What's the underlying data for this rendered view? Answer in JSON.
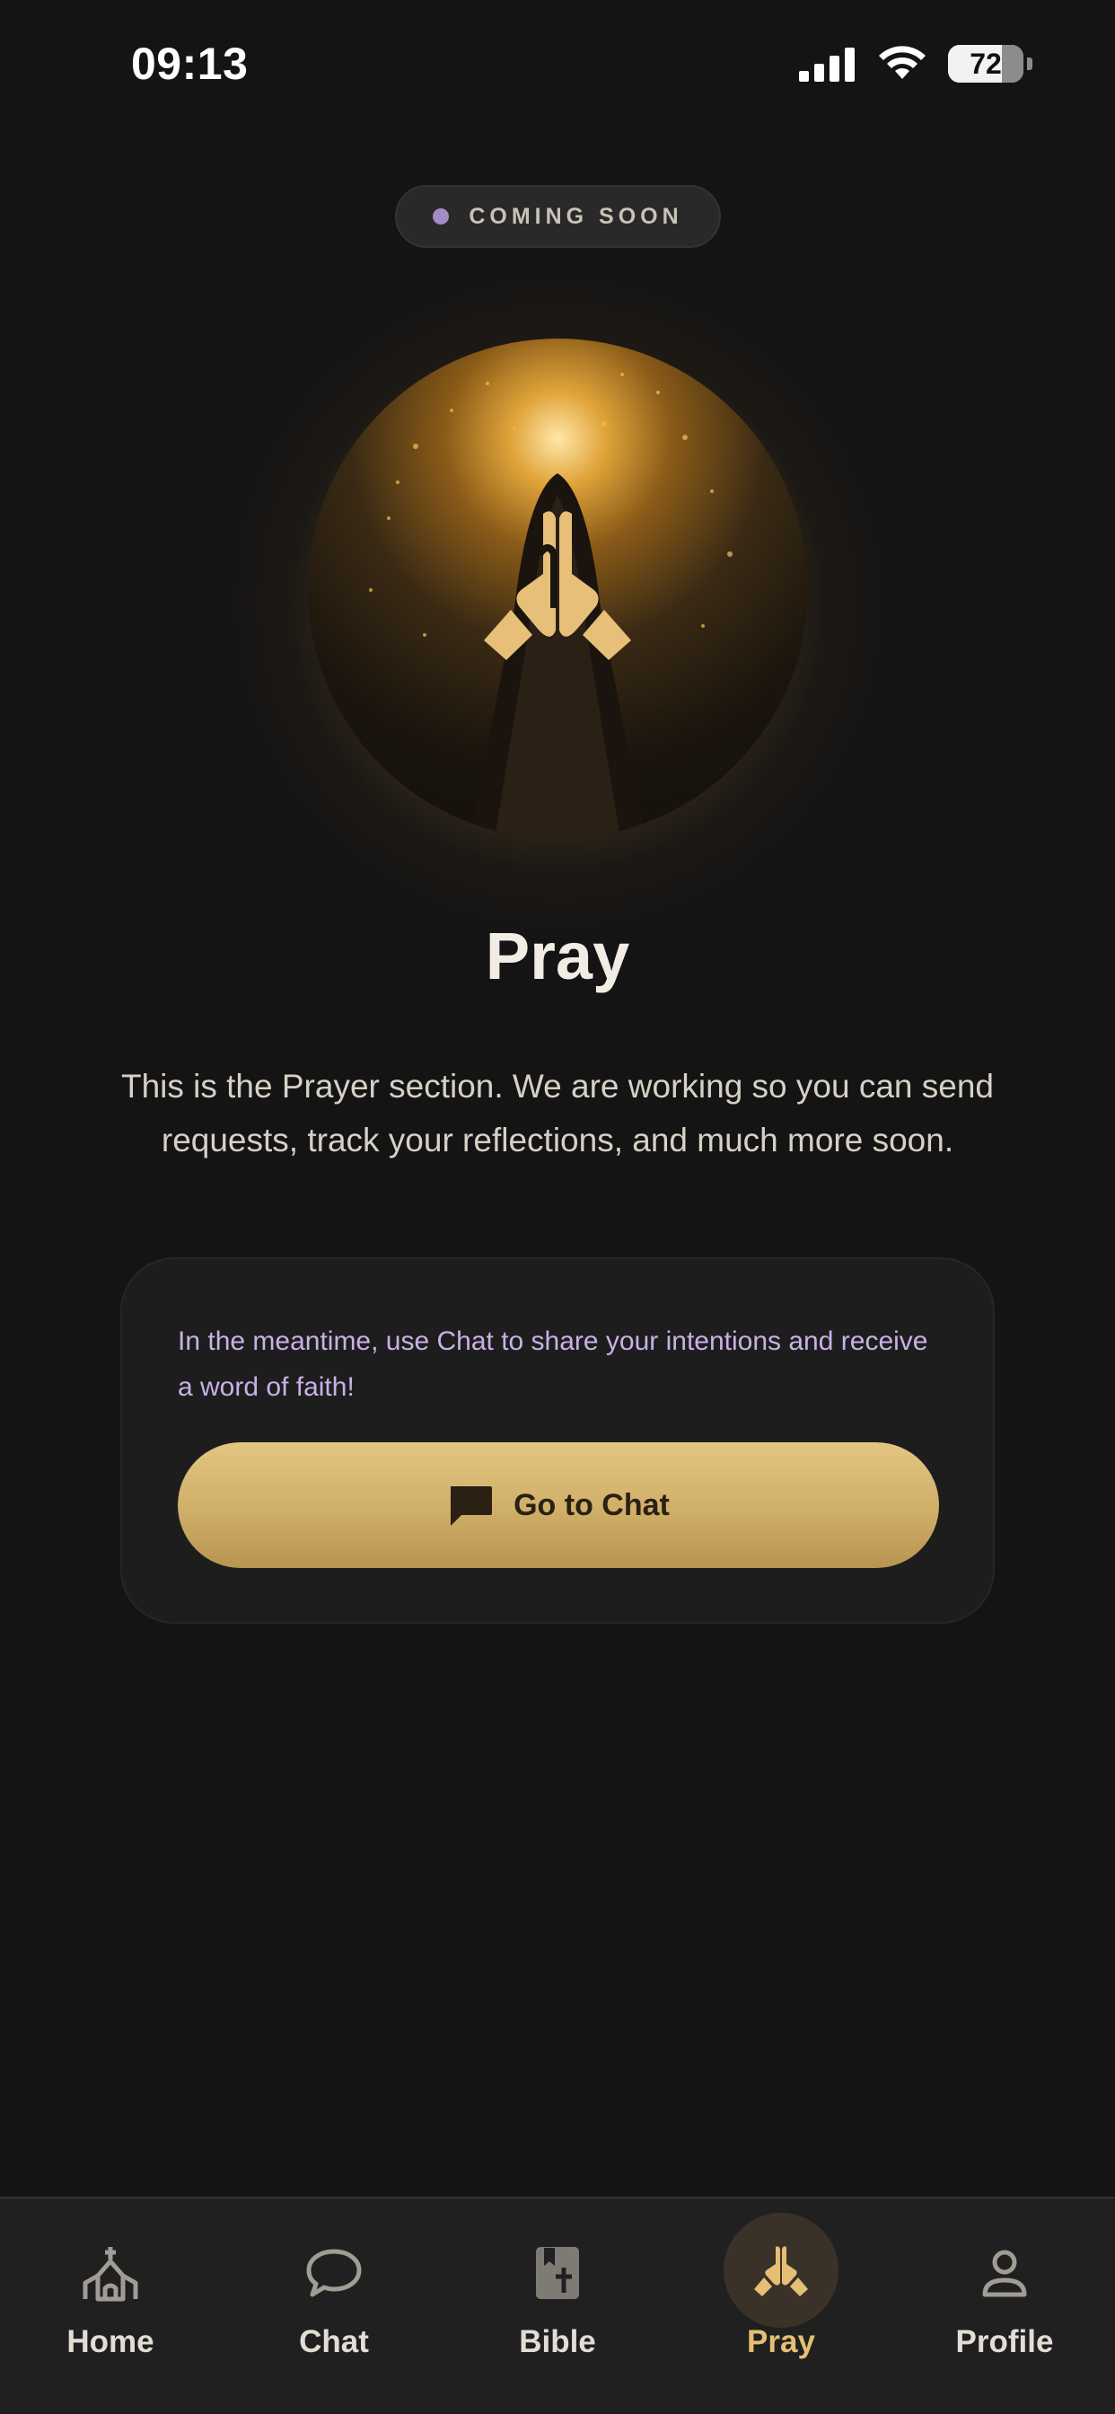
{
  "status_bar": {
    "time": "09:13",
    "battery": "72"
  },
  "badge": {
    "text": "COMING SOON",
    "dot_color": "#A48CC6"
  },
  "page": {
    "title": "Pray",
    "description": "This is the Prayer section. We are working so you can send requests, track your reflections, and much more soon."
  },
  "card": {
    "text": "In the meantime, use Chat to share your intentions and receive a word of faith!",
    "button_label": "Go to Chat",
    "button_icon": "chat-bubble-icon"
  },
  "tabs": [
    {
      "label": "Home",
      "icon": "church-icon",
      "active": false
    },
    {
      "label": "Chat",
      "icon": "chat-icon",
      "active": false
    },
    {
      "label": "Bible",
      "icon": "bible-icon",
      "active": false
    },
    {
      "label": "Pray",
      "icon": "praying-hands-icon",
      "active": true
    },
    {
      "label": "Profile",
      "icon": "profile-icon",
      "active": false
    }
  ],
  "colors": {
    "background": "#151414",
    "accent_gold": "#E5BF74",
    "card": "#1E1D1D",
    "purple_text": "#C7B1E6"
  }
}
